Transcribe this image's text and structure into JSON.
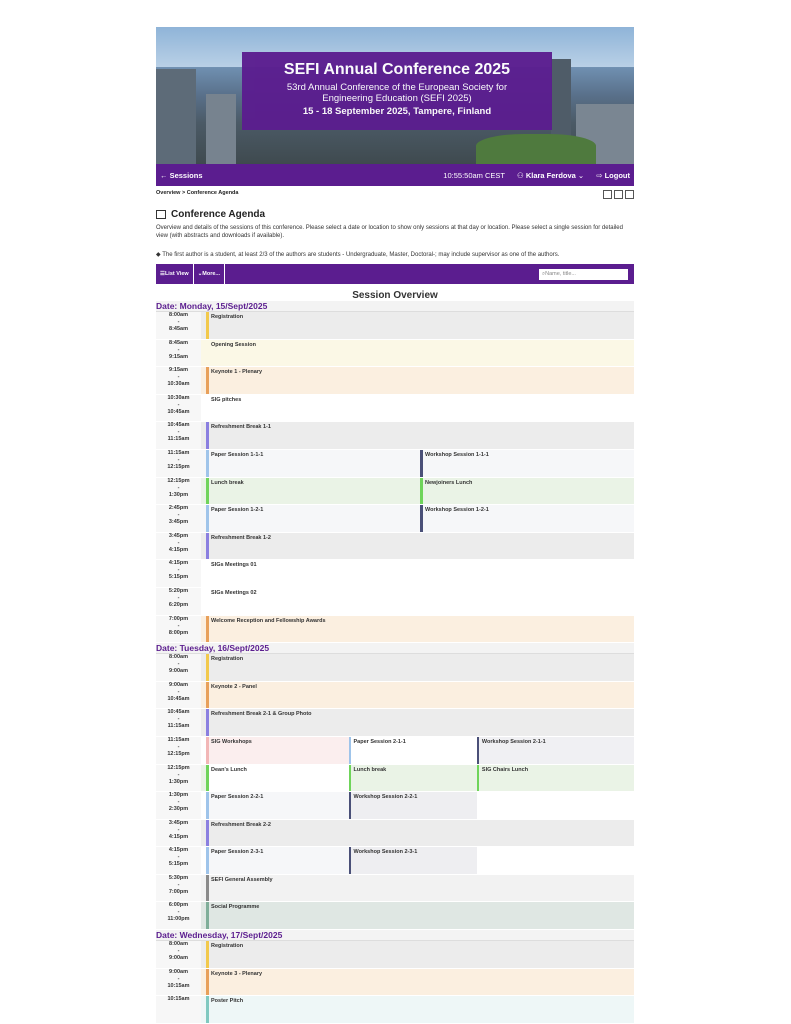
{
  "banner": {
    "title": "SEFI Annual Conference 2025",
    "subtitle": "53rd Annual Conference of the European Society for Engineering Education (SEFI 2025)",
    "dates": "15 - 18 September 2025, Tampere, Finland"
  },
  "nav": {
    "back": "← Sessions",
    "time": "10:55:50am CEST",
    "user": "Klara Ferdova",
    "logout": "Logout"
  },
  "breadcrumb": "Overview > Conference Agenda",
  "heading": "Conference Agenda",
  "description": "Overview and details of the sessions of this conference. Please select a date or location to show only sessions at that day or location. Please select a single session for detailed view (with abstracts and downloads if available).",
  "note": "The first author is a student, at least 2/3 of the authors are students - Undergraduate, Master, Doctoral-; may include supervisor as one of the authors.",
  "toolbar": {
    "list_view": "List View",
    "more": "More...",
    "search_placeholder": "Name, title..."
  },
  "overview_title": "Session Overview",
  "colors": {
    "purple": "#5b1d8f",
    "yellow": "#f2c94c",
    "orange": "#e8a05a",
    "blue": "#8a7fe0",
    "lightblue": "#9fc4ea",
    "navy": "#4a5078",
    "green": "#6fd45a",
    "pink": "#f2b7b7",
    "gray": "#8a8a8a",
    "teal": "#7fc9c0"
  },
  "days": [
    {
      "label": "Date: Monday, 15/Sept/2025",
      "rows": [
        {
          "start": "8:00am",
          "end": "8:45am",
          "bg": "#ececec",
          "cells": [
            {
              "title": "Registration",
              "bar": "#f2c94c",
              "w": 1
            }
          ]
        },
        {
          "start": "8:45am",
          "end": "9:15am",
          "bg": "#fbf8e6",
          "cells": [
            {
              "title": "Opening Session",
              "bar": "",
              "w": 1
            }
          ]
        },
        {
          "start": "9:15am",
          "end": "10:30am",
          "bg": "#fbefe0",
          "cells": [
            {
              "title": "Keynote 1 - Plenary",
              "bar": "#e8a05a",
              "w": 1
            }
          ]
        },
        {
          "start": "10:30am",
          "end": "10:45am",
          "bg": "#ffffff",
          "cells": [
            {
              "title": "SIG pitches",
              "bar": "",
              "w": 1
            }
          ]
        },
        {
          "start": "10:45am",
          "end": "11:15am",
          "bg": "#ececec",
          "cells": [
            {
              "title": "Refreshment Break 1-1",
              "bar": "#8a7fe0",
              "w": 1
            }
          ]
        },
        {
          "start": "11:15am",
          "end": "12:15pm",
          "bg": "#f6f7f9",
          "cells": [
            {
              "title": "Paper Session 1-1-1",
              "bar": "#9fc4ea",
              "w": 0.5
            },
            {
              "title": "Workshop Session 1-1-1",
              "bar": "#4a5078",
              "w": 0.5
            }
          ]
        },
        {
          "start": "12:15pm",
          "end": "1:30pm",
          "bg": "#eaf3e6",
          "cells": [
            {
              "title": "Lunch break",
              "bar": "#6fd45a",
              "w": 0.5
            },
            {
              "title": "Newjoiners Lunch",
              "bar": "#6fd45a",
              "w": 0.5
            }
          ]
        },
        {
          "start": "2:45pm",
          "end": "3:45pm",
          "bg": "#f6f7f9",
          "cells": [
            {
              "title": "Paper Session 1-2-1",
              "bar": "#9fc4ea",
              "w": 0.5
            },
            {
              "title": "Workshop Session 1-2-1",
              "bar": "#4a5078",
              "w": 0.5
            }
          ]
        },
        {
          "start": "3:45pm",
          "end": "4:15pm",
          "bg": "#ececec",
          "cells": [
            {
              "title": "Refreshment Break 1-2",
              "bar": "#8a7fe0",
              "w": 1
            }
          ]
        },
        {
          "start": "4:15pm",
          "end": "5:15pm",
          "bg": "#ffffff",
          "cells": [
            {
              "title": "SIGs Meetings 01",
              "bar": "",
              "w": 1
            }
          ]
        },
        {
          "start": "5:20pm",
          "end": "6:20pm",
          "bg": "#ffffff",
          "cells": [
            {
              "title": "SIGs Meetings 02",
              "bar": "",
              "w": 1
            }
          ]
        },
        {
          "start": "7:00pm",
          "end": "8:00pm",
          "bg": "#fbefe0",
          "cells": [
            {
              "title": "Welcome Reception and Fellowship Awards",
              "bar": "#e8a05a",
              "w": 1
            }
          ]
        }
      ]
    },
    {
      "label": "Date: Tuesday, 16/Sept/2025",
      "rows": [
        {
          "start": "8:00am",
          "end": "9:00am",
          "bg": "#ececec",
          "cells": [
            {
              "title": "Registration",
              "bar": "#f2c94c",
              "w": 1
            }
          ]
        },
        {
          "start": "9:00am",
          "end": "10:45am",
          "bg": "#fbefe0",
          "cells": [
            {
              "title": "Keynote 2 - Panel",
              "bar": "#e8a05a",
              "w": 1
            }
          ]
        },
        {
          "start": "10:45am",
          "end": "11:15am",
          "bg": "#ececec",
          "cells": [
            {
              "title": "Refreshment Break 2-1 & Group Photo",
              "bar": "#8a7fe0",
              "w": 1
            }
          ]
        },
        {
          "start": "11:15am",
          "end": "12:15pm",
          "bg": "#ffffff",
          "cells": [
            {
              "title": "SIG Workshops",
              "bar": "#f2b7b7",
              "w": 0.333,
              "bg": "#fbeeee"
            },
            {
              "title": "Paper Session 2-1-1",
              "bar": "#9fc4ea",
              "w": 0.3,
              "bg": "#ffffff"
            },
            {
              "title": "Workshop Session 2-1-1",
              "bar": "#4a5078",
              "w": 0.367,
              "bg": "#f0f0f3"
            }
          ]
        },
        {
          "start": "12:15pm",
          "end": "1:30pm",
          "bg": "#eaf3e6",
          "cells": [
            {
              "title": "Dean's Lunch",
              "bar": "#6fd45a",
              "w": 0.333,
              "bg": "#ffffff"
            },
            {
              "title": "Lunch break",
              "bar": "#6fd45a",
              "w": 0.3
            },
            {
              "title": "SIG Chairs Lunch",
              "bar": "#6fd45a",
              "w": 0.367
            }
          ]
        },
        {
          "start": "1:30pm",
          "end": "2:30pm",
          "bg": "#ffffff",
          "cells": [
            {
              "title": "Paper Session 2-2-1",
              "bar": "#9fc4ea",
              "w": 0.333,
              "bg": "#f6f7f9"
            },
            {
              "title": "Workshop Session 2-2-1",
              "bar": "#4a5078",
              "w": 0.3,
              "bg": "#eeeef1"
            }
          ]
        },
        {
          "start": "3:45pm",
          "end": "4:15pm",
          "bg": "#ececec",
          "cells": [
            {
              "title": "Refreshment Break 2-2",
              "bar": "#8a7fe0",
              "w": 1
            }
          ]
        },
        {
          "start": "4:15pm",
          "end": "5:15pm",
          "bg": "#ffffff",
          "cells": [
            {
              "title": "Paper Session 2-3-1",
              "bar": "#9fc4ea",
              "w": 0.333,
              "bg": "#f6f7f9"
            },
            {
              "title": "Workshop Session 2-3-1",
              "bar": "#4a5078",
              "w": 0.3,
              "bg": "#eeeef1"
            }
          ]
        },
        {
          "start": "5:30pm",
          "end": "7:00pm",
          "bg": "#f2f2f2",
          "cells": [
            {
              "title": "SEFI General Assembly",
              "bar": "#8a8a8a",
              "w": 1
            }
          ]
        },
        {
          "start": "6:00pm",
          "end": "11:00pm",
          "bg": "#dfe7e3",
          "cells": [
            {
              "title": "Social Programme",
              "bar": "#7fae99",
              "w": 1
            }
          ]
        }
      ]
    },
    {
      "label": "Date: Wednesday, 17/Sept/2025",
      "rows": [
        {
          "start": "8:00am",
          "end": "9:00am",
          "bg": "#ececec",
          "cells": [
            {
              "title": "Registration",
              "bar": "#f2c94c",
              "w": 1
            }
          ]
        },
        {
          "start": "9:00am",
          "end": "10:15am",
          "bg": "#fbefe0",
          "cells": [
            {
              "title": "Keynote 3 - Plenary",
              "bar": "#e8a05a",
              "w": 1
            }
          ]
        },
        {
          "start": "10:15am",
          "end": "",
          "bg": "#eef7f7",
          "cells": [
            {
              "title": "Poster Pitch",
              "bar": "#7fc9c0",
              "w": 1
            }
          ]
        }
      ]
    }
  ]
}
